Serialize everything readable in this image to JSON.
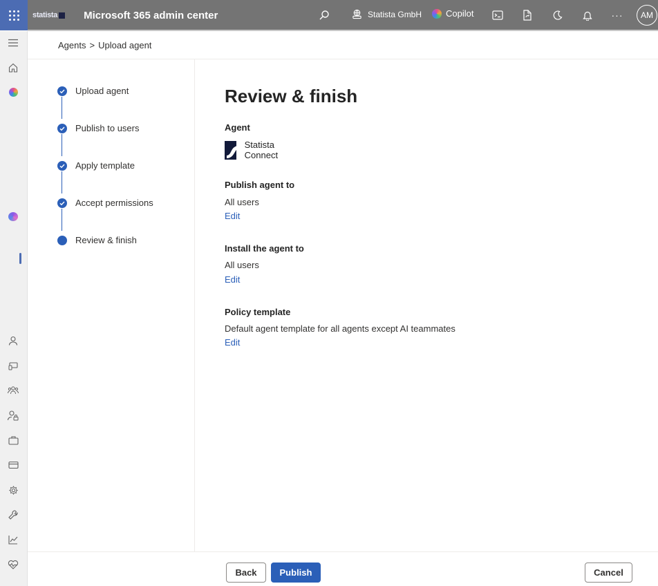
{
  "header": {
    "brand": "statista",
    "app_title": "Microsoft 365 admin center",
    "org_name": "Statista GmbH",
    "copilot_label": "Copilot",
    "more": "···",
    "avatar_initials": "AM"
  },
  "breadcrumb": {
    "parent": "Agents",
    "separator": ">",
    "current": "Upload agent"
  },
  "stepper": {
    "steps": [
      {
        "label": "Upload agent",
        "status": "completed"
      },
      {
        "label": "Publish to users",
        "status": "completed"
      },
      {
        "label": "Apply template",
        "status": "completed"
      },
      {
        "label": "Accept permissions",
        "status": "completed"
      },
      {
        "label": "Review & finish",
        "status": "current"
      }
    ]
  },
  "main": {
    "title": "Review & finish",
    "agent": {
      "heading": "Agent",
      "name": "Statista Connect"
    },
    "publish": {
      "heading": "Publish agent to",
      "value": "All users",
      "edit": "Edit"
    },
    "install": {
      "heading": "Install the agent to",
      "value": "All users",
      "edit": "Edit"
    },
    "policy": {
      "heading": "Policy template",
      "value": "Default agent template for all agents except AI teammates",
      "edit": "Edit"
    }
  },
  "footer": {
    "back": "Back",
    "publish": "Publish",
    "cancel": "Cancel"
  },
  "colors": {
    "accent": "#2b5fb8",
    "topbar": "#747474",
    "waffle_bg": "#4c6cb3"
  }
}
